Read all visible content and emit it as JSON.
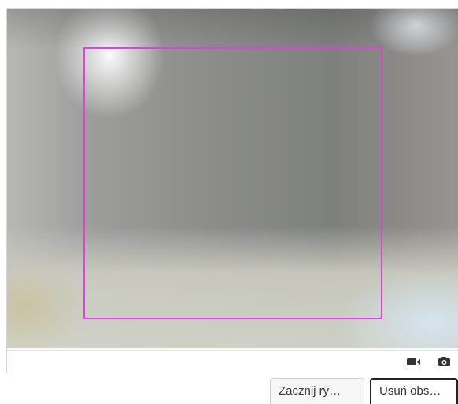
{
  "camera_view": {
    "detection_box_color": "#e040e0"
  },
  "controls": {
    "video_icon": "video-camera-icon",
    "snapshot_icon": "camera-icon"
  },
  "buttons": {
    "start_label": "Zacznij ry…",
    "remove_label": "Usuń obs…"
  }
}
